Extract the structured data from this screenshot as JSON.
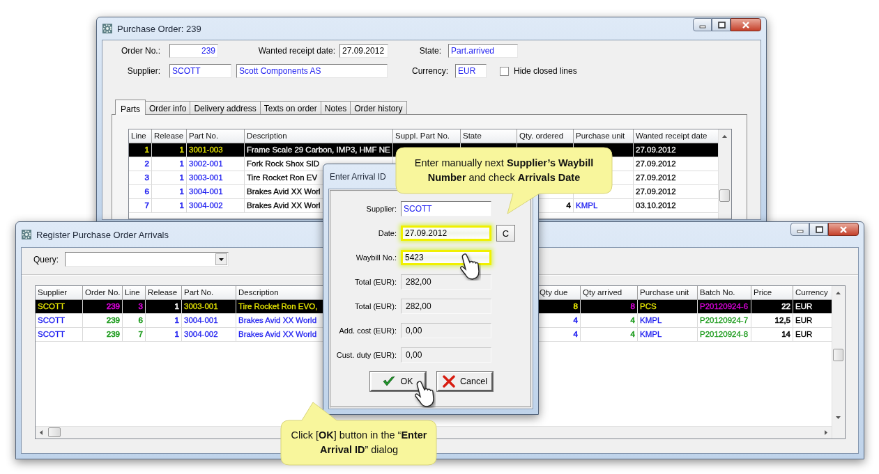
{
  "purchase_order_window": {
    "title": "Purchase Order: 239",
    "order_no": {
      "label": "Order No.:",
      "value": "239"
    },
    "wanted_receipt_date": {
      "label": "Wanted receipt date:",
      "value": "27.09.2012"
    },
    "state": {
      "label": "State:",
      "value": "Part.arrived"
    },
    "supplier": {
      "label": "Supplier:",
      "code": "SCOTT",
      "name": "Scott Components AS"
    },
    "currency": {
      "label": "Currency:",
      "value": "EUR"
    },
    "hide_closed_lines": {
      "label": "Hide closed lines",
      "checked": false
    },
    "tabs": [
      {
        "label": "Parts",
        "selected": true
      },
      {
        "label": "Order info",
        "selected": false
      },
      {
        "label": "Delivery address",
        "selected": false
      },
      {
        "label": "Texts on order",
        "selected": false
      },
      {
        "label": "Notes",
        "selected": false
      },
      {
        "label": "Order history",
        "selected": false
      }
    ],
    "table": {
      "columns": [
        {
          "label": "Line",
          "kind": "number"
        },
        {
          "label": "Release",
          "kind": "number"
        },
        {
          "label": "Part No.",
          "kind": "text"
        },
        {
          "label": "Description",
          "kind": "text"
        },
        {
          "label": "Suppl. Part No.",
          "kind": "text"
        },
        {
          "label": "State",
          "kind": "text"
        },
        {
          "label": "Qty. ordered",
          "kind": "number"
        },
        {
          "label": "Purchase unit",
          "kind": "text"
        },
        {
          "label": "Wanted receipt date",
          "kind": "text"
        }
      ],
      "rows": [
        {
          "selected": true,
          "cells": [
            {
              "text": "1",
              "color": "#e6e600"
            },
            {
              "text": "1",
              "color": "#e6e600"
            },
            {
              "text": "3001-003",
              "color": "#e6e600"
            },
            {
              "text": "Frame Scale 29 Carbon, IMP3, HMF NE",
              "color": "#ffffff"
            },
            null,
            null,
            null,
            null,
            {
              "text": "27.09.2012",
              "color": "#ffffff"
            }
          ]
        },
        {
          "selected": false,
          "cells": [
            {
              "text": "2",
              "color": "#1c1cf0"
            },
            {
              "text": "1",
              "color": "#1c1cf0"
            },
            {
              "text": "3002-001",
              "color": "#1c1cf0"
            },
            {
              "text": "Fork Rock Shox SID",
              "color": "#000000"
            },
            null,
            null,
            null,
            null,
            {
              "text": "27.09.2012",
              "color": "#000000"
            }
          ]
        },
        {
          "selected": false,
          "cells": [
            {
              "text": "3",
              "color": "#1c1cf0"
            },
            {
              "text": "1",
              "color": "#1c1cf0"
            },
            {
              "text": "3003-001",
              "color": "#1c1cf0"
            },
            {
              "text": "Tire Rocket Ron EV",
              "color": "#000000"
            },
            null,
            null,
            null,
            null,
            {
              "text": "27.09.2012",
              "color": "#000000"
            }
          ]
        },
        {
          "selected": false,
          "cells": [
            {
              "text": "6",
              "color": "#1c1cf0"
            },
            {
              "text": "1",
              "color": "#1c1cf0"
            },
            {
              "text": "3004-001",
              "color": "#1c1cf0"
            },
            {
              "text": "Brakes Avid XX Worl",
              "color": "#000000"
            },
            null,
            null,
            null,
            null,
            {
              "text": "27.09.2012",
              "color": "#000000"
            }
          ]
        },
        {
          "selected": false,
          "cells": [
            {
              "text": "7",
              "color": "#1c1cf0"
            },
            {
              "text": "1",
              "color": "#1c1cf0"
            },
            {
              "text": "3004-002",
              "color": "#1c1cf0"
            },
            {
              "text": "Brakes Avid XX Worl",
              "color": "#000000"
            },
            null,
            null,
            {
              "text": "4",
              "color": "#000000"
            },
            {
              "text": "KMPL",
              "color": "#1c1cf0"
            },
            {
              "text": "03.10.2012",
              "color": "#000000"
            }
          ]
        }
      ]
    }
  },
  "arrivals_window": {
    "title": "Register Purchase Order Arrivals",
    "query": {
      "label": "Query:"
    },
    "table": {
      "columns": [
        {
          "label": "Supplier",
          "kind": "text"
        },
        {
          "label": "Order No.",
          "kind": "number"
        },
        {
          "label": "Line",
          "kind": "number"
        },
        {
          "label": "Release",
          "kind": "number"
        },
        {
          "label": "Part No.",
          "kind": "text"
        },
        {
          "label": "Description",
          "kind": "text"
        },
        {
          "label": "Qty due",
          "kind": "number"
        },
        {
          "label": "Qty arrived",
          "kind": "number"
        },
        {
          "label": "Purchase unit",
          "kind": "text"
        },
        {
          "label": "Batch No.",
          "kind": "text"
        },
        {
          "label": "Price",
          "kind": "number"
        },
        {
          "label": "Currency",
          "kind": "text"
        }
      ],
      "rows": [
        {
          "selected": true,
          "cells": [
            {
              "text": "SCOTT",
              "color": "#e6e600"
            },
            {
              "text": "239",
              "color": "#e000e0"
            },
            {
              "text": "3",
              "color": "#e000e0"
            },
            {
              "text": "1",
              "color": "#ffffff"
            },
            {
              "text": "3003-001",
              "color": "#e6e600"
            },
            {
              "text": "Tire Rocket Ron EVO,",
              "color": "#e6e600"
            },
            {
              "text": "8",
              "color": "#e6e600"
            },
            {
              "text": "8",
              "color": "#e000e0"
            },
            {
              "text": "PCS",
              "color": "#e6e600"
            },
            {
              "text": "P20120924-6",
              "color": "#e000e0"
            },
            {
              "text": "22",
              "color": "#ffffff"
            },
            {
              "text": "EUR",
              "color": "#ffffff"
            }
          ]
        },
        {
          "selected": false,
          "cells": [
            {
              "text": "SCOTT",
              "color": "#1c1cf0"
            },
            {
              "text": "239",
              "color": "#1a9a1a"
            },
            {
              "text": "6",
              "color": "#1a9a1a"
            },
            {
              "text": "1",
              "color": "#1c1cf0"
            },
            {
              "text": "3004-001",
              "color": "#1c1cf0"
            },
            {
              "text": "Brakes Avid XX World",
              "color": "#1c1cf0"
            },
            {
              "text": "4",
              "color": "#1c1cf0"
            },
            {
              "text": "4",
              "color": "#1a9a1a"
            },
            {
              "text": "KMPL",
              "color": "#1c1cf0"
            },
            {
              "text": "P20120924-7",
              "color": "#1a9a1a"
            },
            {
              "text": "12,5",
              "color": "#000000"
            },
            {
              "text": "EUR",
              "color": "#000000"
            }
          ]
        },
        {
          "selected": false,
          "cells": [
            {
              "text": "SCOTT",
              "color": "#1c1cf0"
            },
            {
              "text": "239",
              "color": "#1a9a1a"
            },
            {
              "text": "7",
              "color": "#1a9a1a"
            },
            {
              "text": "1",
              "color": "#1c1cf0"
            },
            {
              "text": "3004-002",
              "color": "#1c1cf0"
            },
            {
              "text": "Brakes Avid XX World",
              "color": "#1c1cf0"
            },
            {
              "text": "4",
              "color": "#1c1cf0"
            },
            {
              "text": "4",
              "color": "#1a9a1a"
            },
            {
              "text": "KMPL",
              "color": "#1c1cf0"
            },
            {
              "text": "P20120924-8",
              "color": "#1a9a1a"
            },
            {
              "text": "14",
              "color": "#000000"
            },
            {
              "text": "EUR",
              "color": "#000000"
            }
          ]
        }
      ]
    }
  },
  "dialog": {
    "title": "Enter Arrival ID",
    "fields": [
      {
        "label": "Supplier:",
        "value": "SCOTT",
        "kind": "input",
        "highlighted": false,
        "color": "#1c1cf0"
      },
      {
        "label": "Date:",
        "value": "27.09.2012",
        "kind": "input",
        "highlighted": true,
        "color": "#000000",
        "button": "C"
      },
      {
        "label": "Waybill No.:",
        "value": "5423",
        "kind": "input",
        "highlighted": true,
        "color": "#000000"
      },
      {
        "label": "Total (EUR):",
        "value": "282,00",
        "kind": "readonly",
        "highlighted": false,
        "color": "#000000"
      },
      {
        "label": "Total (EUR):",
        "value": "282,00",
        "kind": "readonly",
        "highlighted": false,
        "color": "#000000"
      },
      {
        "label": "Add. cost (EUR):",
        "value": "0,00",
        "kind": "readonly",
        "highlighted": false,
        "color": "#000000"
      },
      {
        "label": "Cust. duty (EUR):",
        "value": "0,00",
        "kind": "readonly",
        "highlighted": false,
        "color": "#000000"
      }
    ],
    "buttons": [
      {
        "label": "OK",
        "kind": "ok"
      },
      {
        "label": "Cancel",
        "kind": "cancel"
      }
    ]
  },
  "callouts": [
    {
      "text": "Enter manually next **Supplier’s Waybill Number** and check **Arrivals Date**"
    },
    {
      "text": "Click [**OK**] button in the “**Enter Arrival ID**” dialog"
    }
  ]
}
